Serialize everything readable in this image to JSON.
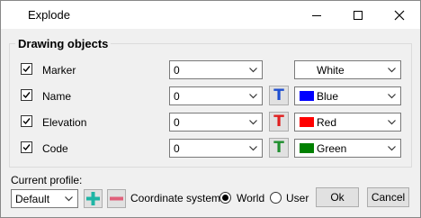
{
  "window": {
    "title": "Explode"
  },
  "group": {
    "title": "Drawing objects"
  },
  "rows": [
    {
      "label": "Marker",
      "checked": true,
      "value": "0",
      "color_label": "White",
      "color_hex": "#ffffff",
      "text_color": ""
    },
    {
      "label": "Name",
      "checked": true,
      "value": "0",
      "color_label": "Blue",
      "color_hex": "#0000ff",
      "text_color": "#1f4fd0"
    },
    {
      "label": "Elevation",
      "checked": true,
      "value": "0",
      "color_label": "Red",
      "color_hex": "#ff0000",
      "text_color": "#e02020"
    },
    {
      "label": "Code",
      "checked": true,
      "value": "0",
      "color_label": "Green",
      "color_hex": "#008000",
      "text_color": "#1f8f2f"
    }
  ],
  "text_button_glyph": "T",
  "profile": {
    "label": "Current profile:",
    "selected": "Default"
  },
  "coordinate": {
    "label": "Coordinate system:",
    "options": [
      "World",
      "User"
    ],
    "selected": "World"
  },
  "buttons": {
    "ok": "Ok",
    "cancel": "Cancel"
  },
  "colors": {
    "add": "#1fb5a5",
    "remove": "#e0607a"
  }
}
